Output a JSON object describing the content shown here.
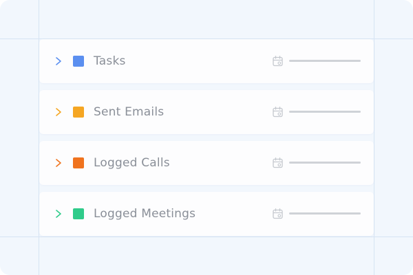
{
  "rows": [
    {
      "label": "Tasks",
      "color": "#5b8ff0",
      "icon": "chevron-right-icon"
    },
    {
      "label": "Sent Emails",
      "color": "#f5a623",
      "icon": "chevron-right-icon"
    },
    {
      "label": "Logged Calls",
      "color": "#f0731e",
      "icon": "chevron-right-icon"
    },
    {
      "label": "Logged Meetings",
      "color": "#2fcb8a",
      "icon": "chevron-right-icon"
    }
  ],
  "icons": {
    "date": "calendar-icon",
    "value_placeholder": "placeholder-bar"
  }
}
